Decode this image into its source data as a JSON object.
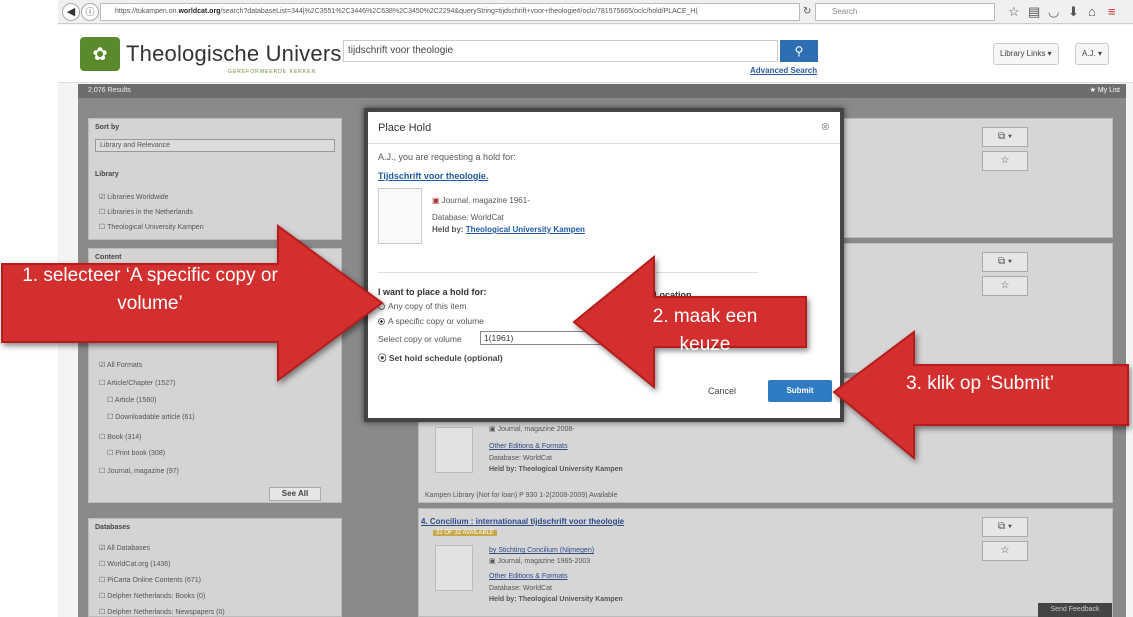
{
  "browser": {
    "url_prefix": "https://tukampen.on.",
    "url_host": "worldcat.org",
    "url_rest": "/search?databaseList=344|%2C3551%2C3446%2C638%2C3450%2C2294&queryString=tijdschrift+voor+theologie#/oclc/781575665/oclc/hold/PLACE_H(",
    "search_placeholder": "Search"
  },
  "site": {
    "brand": "Theologische Universiteit",
    "brand_sub": "GEREFORMEERDE KERKEN",
    "search_value": "tijdschrift voor theologie",
    "advanced_search": "Advanced Search",
    "library_links": "Library Links ▾",
    "user_menu": "A.J. ▾"
  },
  "results_bar": {
    "count": "2,076 Results",
    "my_list": "★ My List"
  },
  "sidebar": {
    "sort_by": "Sort by",
    "sort_value": "Library and Relevance",
    "library_head": "Library",
    "library_items": [
      "Libraries Worldwide",
      "Libraries in the Netherlands",
      "Theological University Kampen"
    ],
    "content_head": "Content",
    "format_items": [
      "All Formats",
      "Article/Chapter (1527)",
      "Article (1560)",
      "Downloadable article (61)",
      "Book (314)",
      "Print book (308)",
      "Journal, magazine (97)"
    ],
    "see_all": "See All",
    "databases_head": "Databases",
    "database_items": [
      "All Databases",
      "WorldCat.org (1436)",
      "PiCarta Online Contents (671)",
      "Delpher Netherlands: Books (0)",
      "Delpher Netherlands: Newspapers (0)"
    ]
  },
  "results": {
    "r3_type": "Journal, magazine 2008-",
    "r3_other": "Other Editions & Formats",
    "r3_db": "Database: WorldCat",
    "r3_held": "Held by: Theological University Kampen",
    "r3_avail_line": "Kampen Library (Not for loan)    P 930    1-2(2008-2009) Available",
    "r4_title": "4. Concilium : internationaal tijdschrift voor theologie",
    "r4_badge": "32 OF 32 AVAILABLE",
    "r4_by": "by Stichting Concilium (Nijmegen)",
    "r4_type": "Journal, magazine 1965-2003",
    "r4_other": "Other Editions & Formats",
    "r4_db": "Database: WorldCat",
    "r4_held": "Held by: Theological University Kampen"
  },
  "modal": {
    "title": "Place Hold",
    "close": "⊗",
    "requesting": "A.J., you are requesting a hold for:",
    "item_title": "Tijdschrift voor theologie.",
    "item_type": "Journal, magazine 1961-",
    "database": "Database: WorldCat",
    "held_by_label": "Held by:",
    "held_by_value": "Theological University Kampen",
    "hold_label": "I want to place a hold for:",
    "option_any": "Any copy of this item",
    "option_specific": "A specific copy or volume",
    "select_label": "Select copy or volume",
    "select_value": "1(1961)",
    "schedule": "Set hold schedule (optional)",
    "location_label": "Location",
    "cancel": "Cancel",
    "submit": "Submit"
  },
  "annotations": {
    "step1": "1. selecteer ‘A specific copy or volume’",
    "step2": "2. maak een keuze",
    "step3": "3. klik op ‘Submit’",
    "arrow_color": "#d32f2f"
  },
  "feedback": "Send Feedback"
}
